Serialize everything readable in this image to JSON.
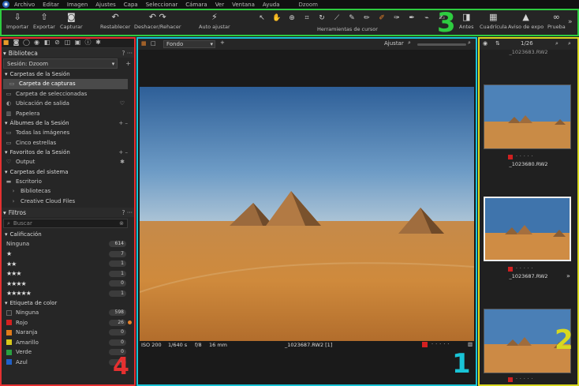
{
  "menubar": {
    "items": [
      "Archivo",
      "Editar",
      "Imagen",
      "Ajustes",
      "Capa",
      "Seleccionar",
      "Cámara",
      "Ver",
      "Ventana",
      "Ayuda"
    ],
    "app_title": "Dzoom"
  },
  "toolbar": {
    "import": "Importar",
    "export": "Exportar",
    "capture": "Capturar",
    "reset": "Restablecer",
    "undo_redo": "Deshacer/Rehacer",
    "auto_adjust": "Auto ajustar",
    "cursor_tools": "Herramientas de cursor",
    "before": "Antes",
    "grid": "Cuadrícula",
    "exposure_warning": "Aviso de expo",
    "proof": "Prueba",
    "callout": "3"
  },
  "left": {
    "library_title": "Biblioteca",
    "session_select": "Sesión: Dzoom",
    "session_folders_title": "Carpetas de la Sesión",
    "session_folders": [
      "Carpeta de capturas",
      "Carpeta de seleccionadas",
      "Ubicación de salida",
      "Papelera"
    ],
    "albums_title": "Álbumes de la Sesión",
    "albums": [
      "Todas las imágenes",
      "Cinco estrellas"
    ],
    "favorites_title": "Favoritos de la Sesión",
    "favorites": [
      "Output"
    ],
    "system_title": "Carpetas del sistema",
    "system": [
      "Escritorio",
      "Bibliotecas",
      "Creative Cloud Files"
    ],
    "filters_title": "Filtros",
    "search_placeholder": "Buscar",
    "rating_title": "Calificación",
    "ratings": [
      {
        "label": "Ninguna",
        "count": "614"
      },
      {
        "label": "★",
        "count": "7"
      },
      {
        "label": "★★",
        "count": "1"
      },
      {
        "label": "★★★",
        "count": "1"
      },
      {
        "label": "★★★★",
        "count": "0"
      },
      {
        "label": "★★★★★",
        "count": "1"
      }
    ],
    "color_title": "Etiqueta de color",
    "colors": [
      {
        "label": "Ninguna",
        "count": "598",
        "color": "#2a2a2a"
      },
      {
        "label": "Rojo",
        "count": "26",
        "color": "#d42020"
      },
      {
        "label": "Naranja",
        "count": "0",
        "color": "#e07a1a"
      },
      {
        "label": "Amarillo",
        "count": "0",
        "color": "#d8c81a"
      },
      {
        "label": "Verde",
        "count": "0",
        "color": "#2aa040"
      },
      {
        "label": "Azul",
        "count": "0",
        "color": "#2060c8"
      }
    ],
    "callout": "4"
  },
  "viewer": {
    "layer": "Fondo",
    "fit": "Ajustar",
    "iso": "ISO 200",
    "shutter": "1/640 s",
    "aperture": "f/8",
    "focal": "16 mm",
    "filename": "_1023687.RW2 [1]",
    "callout": "1"
  },
  "browser": {
    "counter": "1/26",
    "top_name": "_1023683.RW2",
    "thumb1_name": "_1023680.RW2",
    "thumb2_name": "_1023687.RW2",
    "callout": "2"
  },
  "colors": {
    "accent_orange": "#e8822a",
    "frame_viewer": "#19c4d6",
    "frame_browser": "#d8d820",
    "frame_toolbar": "#2ecc40",
    "frame_tools": "#e53030"
  }
}
